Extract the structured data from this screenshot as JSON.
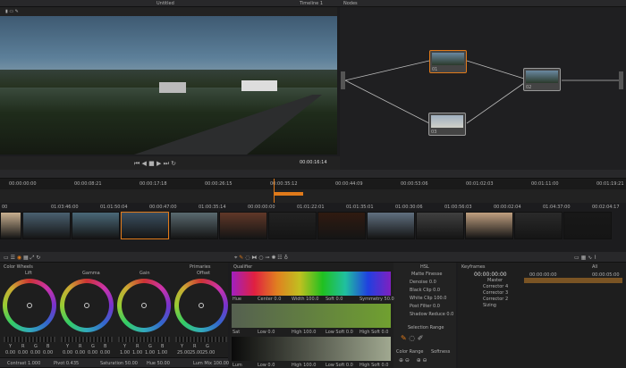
{
  "viewer": {
    "title": "Untitled",
    "clip": "Timeline 1",
    "timecode": "00:00:16:14"
  },
  "nodes": {
    "title": "Nodes",
    "node_labels": [
      "01",
      "02",
      "03"
    ]
  },
  "timeline": {
    "ruler": [
      "00:00:00:00",
      "00:00:08:21",
      "00:00:17:18",
      "00:00:26:15",
      "00:00:35:12",
      "00:00:44:09",
      "00:00:53:06",
      "00:01:02:03",
      "00:01:11:00",
      "00:01:19:21"
    ],
    "clip_timecodes": [
      "00",
      "01:03:46:00",
      "01:01:50:04",
      "00:00:47:00",
      "01:00:35:14",
      "00:00:00:00",
      "01:01:22:01",
      "01:01:35:01",
      "01:00:30:06",
      "01:00:56:03",
      "00:00:02:04",
      "01:04:37:00",
      "00:02:04:17"
    ]
  },
  "color_wheels": {
    "title": "Color Wheels",
    "mode": "Primaries",
    "wheels": [
      {
        "name": "Lift",
        "values": [
          "0.00",
          "0.00",
          "0.00",
          "0.00"
        ]
      },
      {
        "name": "Gamma",
        "values": [
          "0.00",
          "0.00",
          "0.00",
          "0.00"
        ]
      },
      {
        "name": "Gain",
        "values": [
          "1.00",
          "1.00",
          "1.00",
          "1.00"
        ]
      },
      {
        "name": "Offset",
        "values": [
          "25.00",
          "25.00",
          "25.00"
        ]
      }
    ],
    "channels": [
      "Y",
      "R",
      "G",
      "B"
    ],
    "footer": [
      "Contrast 1.000",
      "Pivot 0.435",
      "Saturation 50.00",
      "Hue 50.00",
      "Lum Mix 100.00"
    ]
  },
  "qualifier": {
    "title": "Qualifier",
    "rows": [
      {
        "label": "Hue",
        "fields": [
          "Center 0.0",
          "Width 100.0",
          "Soft 0.0",
          "Symmetry 50.0"
        ]
      },
      {
        "label": "Sat",
        "fields": [
          "Low 0.0",
          "High 100.0",
          "Low Soft 0.0",
          "High Soft 0.0"
        ]
      },
      {
        "label": "Lum",
        "fields": [
          "Low 0.0",
          "High 100.0",
          "Low Soft 0.0",
          "High Soft 0.0"
        ]
      }
    ]
  },
  "hsl": {
    "title": "HSL",
    "matte_finesse": "Matte Finesse",
    "params": [
      "Denoise 0.0",
      "Black Clip 0.0",
      "White Clip 100.0",
      "Post Filter 0.0",
      "Shadow Reduce 0.0"
    ],
    "selection_range": "Selection Range",
    "color_range": "Color Range",
    "softness": "Softness"
  },
  "keyframes": {
    "title": "Keyframes",
    "filter": "All",
    "timecode": "00:00:00:00",
    "tracks": [
      "Master",
      "Corrector 4",
      "Corrector 3",
      "Corrector 2",
      "Sizing"
    ],
    "ruler": [
      "00:00:00:00",
      "00:00:05:00"
    ]
  },
  "colors": {
    "accent": "#e07a1a",
    "panel": "#28282a"
  }
}
